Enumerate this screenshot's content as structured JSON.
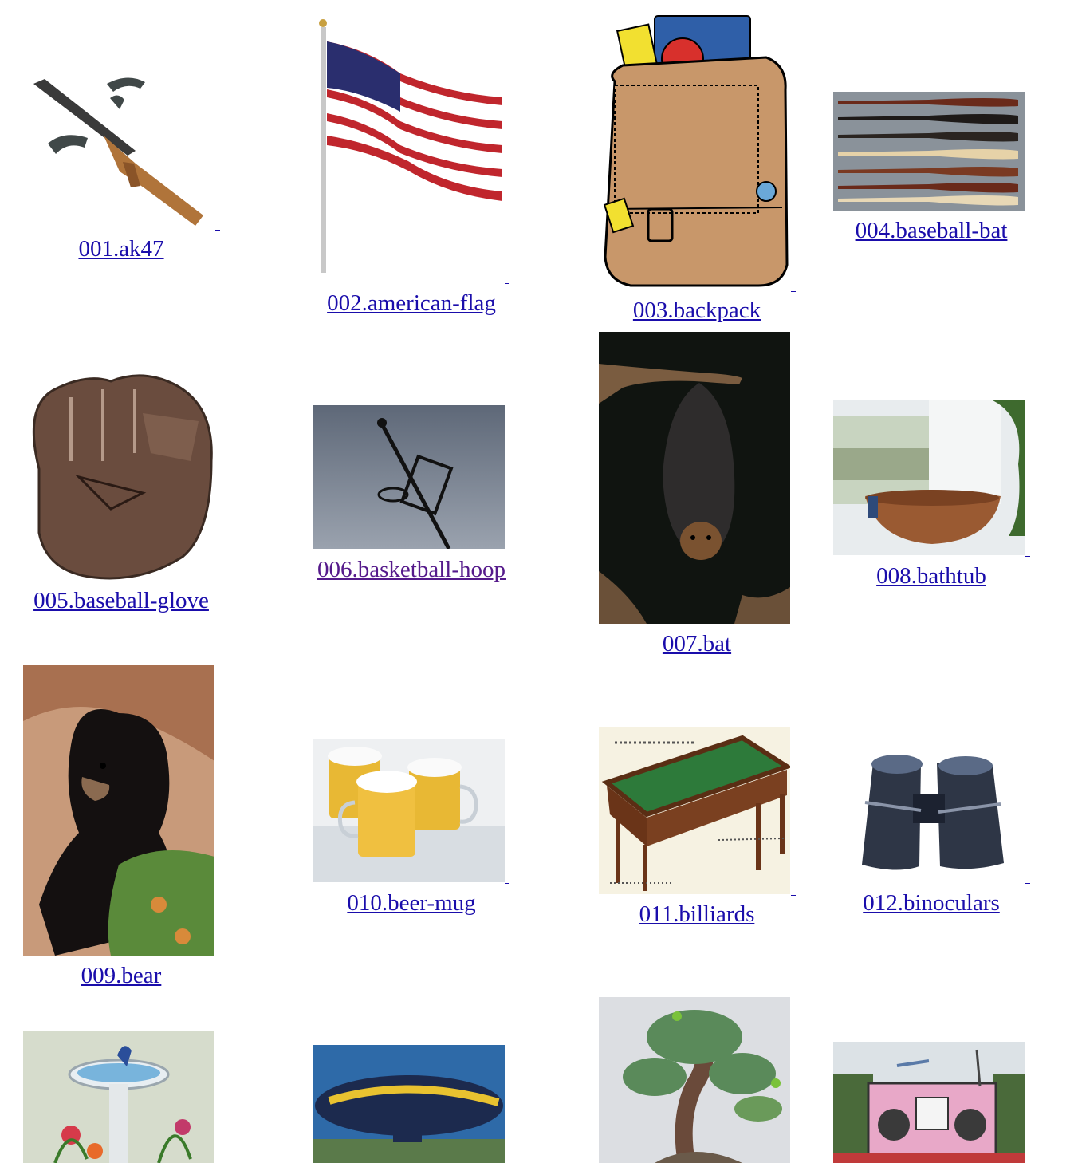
{
  "gallery": {
    "items": [
      {
        "label": "001.ak47",
        "visited": false
      },
      {
        "label": "002.american-flag",
        "visited": false
      },
      {
        "label": "003.backpack",
        "visited": false
      },
      {
        "label": "004.baseball-bat",
        "visited": false
      },
      {
        "label": "005.baseball-glove",
        "visited": false
      },
      {
        "label": "006.basketball-hoop",
        "visited": true
      },
      {
        "label": "007.bat",
        "visited": false
      },
      {
        "label": "008.bathtub",
        "visited": false
      },
      {
        "label": "009.bear",
        "visited": false
      },
      {
        "label": "010.beer-mug",
        "visited": false
      },
      {
        "label": "011.billiards",
        "visited": false
      },
      {
        "label": "012.binoculars",
        "visited": false
      },
      {
        "label": "",
        "visited": false
      },
      {
        "label": "",
        "visited": false
      },
      {
        "label": "",
        "visited": false
      },
      {
        "label": "",
        "visited": false
      }
    ],
    "link_color": "#1a0dab",
    "visited_color": "#551a8b"
  }
}
